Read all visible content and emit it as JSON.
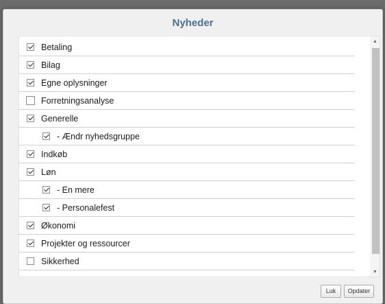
{
  "dialog": {
    "title": "Nyheder"
  },
  "items": [
    {
      "label": "Betaling",
      "checked": true,
      "level": 0
    },
    {
      "label": "Bilag",
      "checked": true,
      "level": 0
    },
    {
      "label": "Egne oplysninger",
      "checked": true,
      "level": 0
    },
    {
      "label": "Forretningsanalyse",
      "checked": false,
      "level": 0
    },
    {
      "label": "Generelle",
      "checked": true,
      "level": 0
    },
    {
      "label": "- Ændr nyhedsgruppe",
      "checked": true,
      "level": 1
    },
    {
      "label": "Indkøb",
      "checked": true,
      "level": 0
    },
    {
      "label": "Løn",
      "checked": true,
      "level": 0
    },
    {
      "label": "- En mere",
      "checked": true,
      "level": 1
    },
    {
      "label": "- Personalefest",
      "checked": true,
      "level": 1
    },
    {
      "label": "Økonomi",
      "checked": true,
      "level": 0
    },
    {
      "label": "Projekter og ressourcer",
      "checked": true,
      "level": 0
    },
    {
      "label": "Sikkerhed",
      "checked": false,
      "level": 0
    }
  ],
  "buttons": {
    "close_label": "Luk",
    "update_label": "Opdater"
  },
  "icons": {
    "scroll_up": "scroll-up-arrow-icon",
    "scroll_down": "scroll-down-arrow-icon"
  },
  "colors": {
    "title": "#4a6f94",
    "scroll_thumb": "#c1c1c1"
  }
}
